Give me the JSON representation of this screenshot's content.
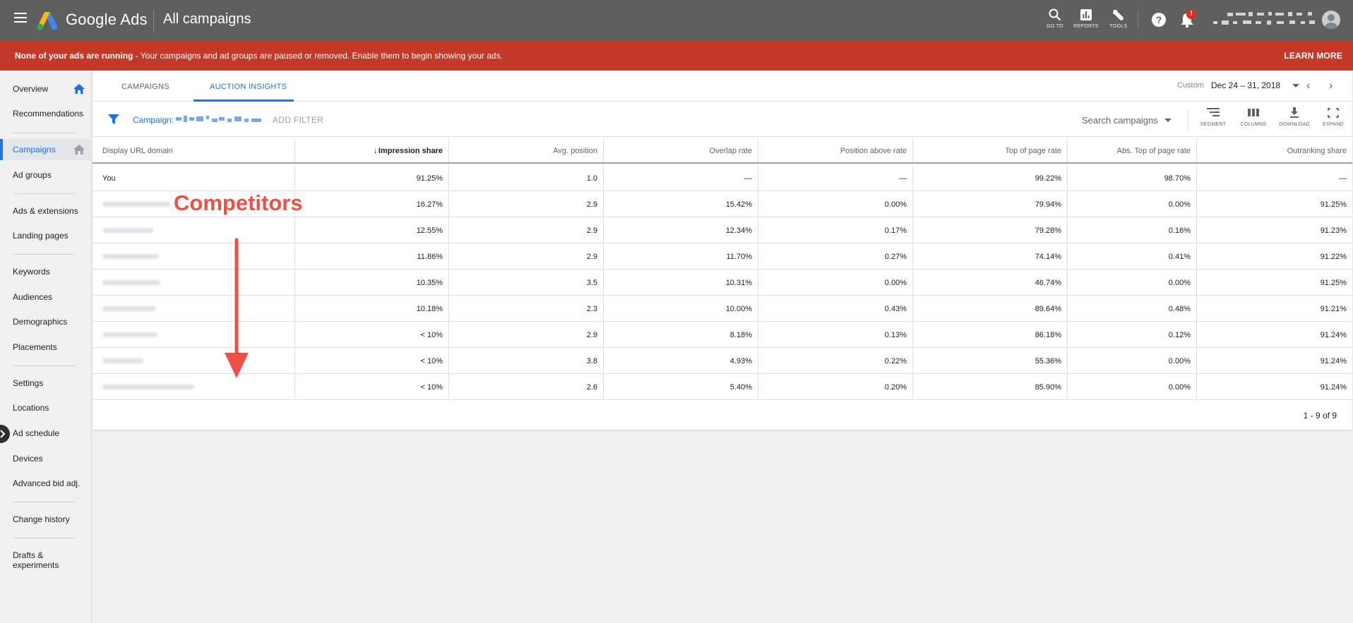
{
  "topbar": {
    "brand": "Google Ads",
    "page_title": "All campaigns",
    "buttons": [
      {
        "label": "GO TO",
        "icon": "search-icon"
      },
      {
        "label": "REPORTS",
        "icon": "reports-icon"
      },
      {
        "label": "TOOLS",
        "icon": "tools-icon"
      }
    ],
    "help_icon": "help-icon",
    "notification_badge": "!",
    "colors": {
      "bar": "#5f5f5f",
      "accent": "#1a73e8",
      "banner": "#c53929"
    }
  },
  "banner": {
    "bold": "None of your ads are running",
    "text": " - Your campaigns and ad groups are paused or removed. Enable them to begin showing your ads.",
    "action": "LEARN MORE"
  },
  "sidebar": {
    "items": [
      {
        "label": "Overview"
      },
      {
        "label": "Recommendations"
      },
      {
        "label": "Campaigns"
      },
      {
        "label": "Ad groups"
      },
      {
        "label": "Ads & extensions"
      },
      {
        "label": "Landing pages"
      },
      {
        "label": "Keywords"
      },
      {
        "label": "Audiences"
      },
      {
        "label": "Demographics"
      },
      {
        "label": "Placements"
      },
      {
        "label": "Settings"
      },
      {
        "label": "Locations"
      },
      {
        "label": "Ad schedule"
      },
      {
        "label": "Devices"
      },
      {
        "label": "Advanced bid adj."
      },
      {
        "label": "Change history"
      },
      {
        "label": "Drafts &"
      },
      {
        "label": "experiments"
      }
    ],
    "active": "Campaigns"
  },
  "tabs": [
    {
      "label": "CAMPAIGNS"
    },
    {
      "label": "AUCTION INSIGHTS"
    }
  ],
  "date_range": {
    "label": "Custom",
    "value": "Dec 24 – 31, 2018"
  },
  "filter": {
    "chip_label": "Campaign:",
    "add_filter": "ADD FILTER",
    "search_placeholder": "Search campaigns"
  },
  "toolbar": [
    {
      "label": "SEGMENT",
      "icon": "segment-icon"
    },
    {
      "label": "COLUMNS",
      "icon": "columns-icon"
    },
    {
      "label": "DOWNLOAD",
      "icon": "download-icon"
    },
    {
      "label": "EXPAND",
      "icon": "expand-icon"
    }
  ],
  "table": {
    "columns": [
      "Display URL domain",
      "Impression share",
      "Avg. position",
      "Overlap rate",
      "Position above rate",
      "Top of page rate",
      "Abs. Top of page rate",
      "Outranking share"
    ],
    "sorted_column": "Impression share",
    "rows": [
      {
        "domain": "You",
        "cells": [
          "91.25%",
          "1.0",
          "—",
          "—",
          "99.22%",
          "98.70%",
          "—"
        ]
      },
      {
        "domain": "",
        "cells": [
          "16.27%",
          "2.9",
          "15.42%",
          "0.00%",
          "79.94%",
          "0.00%",
          "91.25%"
        ]
      },
      {
        "domain": "",
        "cells": [
          "12.55%",
          "2.9",
          "12.34%",
          "0.17%",
          "79.28%",
          "0.16%",
          "91.23%"
        ]
      },
      {
        "domain": "",
        "cells": [
          "11.86%",
          "2.9",
          "11.70%",
          "0.27%",
          "74.14%",
          "0.41%",
          "91.22%"
        ]
      },
      {
        "domain": "",
        "cells": [
          "10.35%",
          "3.5",
          "10.31%",
          "0.00%",
          "46.74%",
          "0.00%",
          "91.25%"
        ]
      },
      {
        "domain": "",
        "cells": [
          "10.18%",
          "2.3",
          "10.00%",
          "0.43%",
          "89.64%",
          "0.48%",
          "91.21%"
        ]
      },
      {
        "domain": "",
        "cells": [
          "< 10%",
          "2.9",
          "8.18%",
          "0.13%",
          "86.18%",
          "0.12%",
          "91.24%"
        ]
      },
      {
        "domain": "",
        "cells": [
          "< 10%",
          "3.8",
          "4.93%",
          "0.22%",
          "55.36%",
          "0.00%",
          "91.24%"
        ]
      },
      {
        "domain": "",
        "cells": [
          "< 10%",
          "2.6",
          "5.40%",
          "0.20%",
          "85.90%",
          "0.00%",
          "91.24%"
        ]
      }
    ],
    "pagination": "1 - 9 of 9"
  },
  "annotation": {
    "text": "Competitors",
    "color": "#ef5043"
  }
}
